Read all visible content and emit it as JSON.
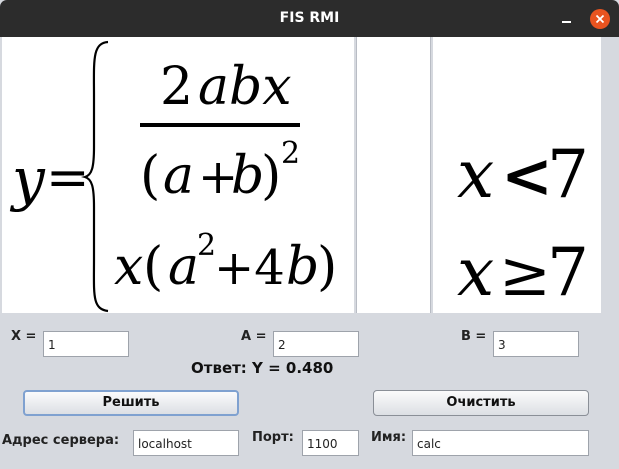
{
  "window": {
    "title": "FIS RMI"
  },
  "formula": {
    "lhs": "y",
    "eq": "=",
    "num_coef": "2",
    "num_vars": "abx",
    "den_open": "(",
    "den_a": "a",
    "den_plus": "+",
    "den_b": "b",
    "den_close": ")",
    "den_exp": "2",
    "row2_x": "x",
    "row2_open": "(",
    "row2_a": "a",
    "row2_exp": "2",
    "row2_plus": "+4",
    "row2_b": "b",
    "row2_close": ")"
  },
  "conditions": {
    "first_var": "x",
    "first_op": "<",
    "first_val": "7",
    "second_var": "x",
    "second_op": "≥",
    "second_val": "7"
  },
  "inputs": {
    "x_label": "X =",
    "x_value": "1",
    "a_label": "A =",
    "a_value": "2",
    "b_label": "B =",
    "b_value": "3"
  },
  "answer": {
    "text": "Ответ: Y = 0.480"
  },
  "buttons": {
    "solve": "Решить",
    "clear": "Очистить"
  },
  "server": {
    "address_label": "Адрес сервера:",
    "address_value": "localhost",
    "port_label": "Порт:",
    "port_value": "1100",
    "name_label": "Имя:",
    "name_value": "calc"
  }
}
